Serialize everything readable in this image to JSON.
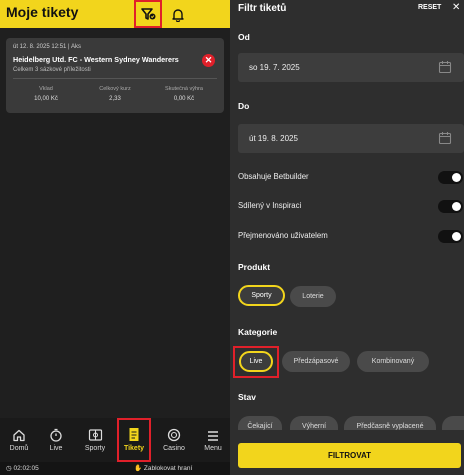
{
  "left": {
    "title": "Moje tikety",
    "ticket": {
      "date": "út 12. 8. 2025 12:51 | Aks",
      "match": "Heidelberg Utd. FC - Western Sydney Wanderers",
      "subtitle": "Celkem 3 sázkové příležitosti",
      "close": "✕",
      "stats": [
        {
          "label": "Vklad",
          "value": "10,00 Kč"
        },
        {
          "label": "Celkový kurz",
          "value": "2,33"
        },
        {
          "label": "Skutečná výhra",
          "value": "0,00 Kč"
        }
      ]
    },
    "nav": [
      {
        "label": "Domů",
        "icon": "home-icon"
      },
      {
        "label": "Live",
        "icon": "stopwatch-icon"
      },
      {
        "label": "Sporty",
        "icon": "sports-icon"
      },
      {
        "label": "Tikety",
        "icon": "ticket-icon",
        "active": true
      },
      {
        "label": "Casino",
        "icon": "casino-chip-icon"
      },
      {
        "label": "Menu",
        "icon": "hamburger-icon"
      }
    ],
    "status": {
      "time": "02:02:05",
      "block": "Zablokovat hraní"
    }
  },
  "right": {
    "title": "Filtr tiketů",
    "reset": "RESET",
    "close": "✕",
    "od_label": "Od",
    "od_value": "so 19. 7. 2025",
    "do_label": "Do",
    "do_value": "út 19. 8. 2025",
    "toggles": [
      {
        "label": "Obsahuje Betbuilder",
        "on": false
      },
      {
        "label": "Sdílený v Inspiraci",
        "on": false
      },
      {
        "label": "Přejmenováno uživatelem",
        "on": false
      }
    ],
    "produkt_label": "Produkt",
    "produkt_chips": [
      {
        "label": "Sporty",
        "selected": true
      },
      {
        "label": "Loterie",
        "selected": false
      }
    ],
    "kategorie_label": "Kategorie",
    "kategorie_chips": [
      {
        "label": "Live",
        "selected": true
      },
      {
        "label": "Předzápasové",
        "selected": false
      },
      {
        "label": "Kombinovaný",
        "selected": false
      }
    ],
    "stav_label": "Stav",
    "stav_chips": [
      {
        "label": "Čekající"
      },
      {
        "label": "Výherní"
      },
      {
        "label": "Předčasně vyplacené"
      }
    ],
    "submit": "FILTROVAT"
  },
  "colors": {
    "accent": "#f2d51c",
    "highlight": "#e0202a",
    "dark": "#1f1f1f"
  }
}
